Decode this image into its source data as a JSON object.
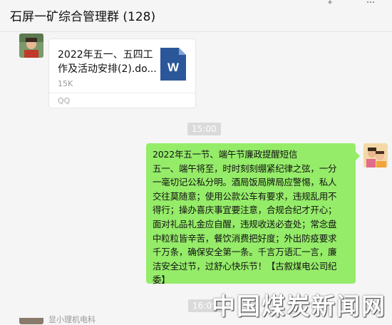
{
  "header": {
    "title": "石屏一矿综合管理群 (128)",
    "pin_icon": "pin-icon",
    "more_icon": "more-icon"
  },
  "messages": {
    "file": {
      "name": "2022年五一、五四工作及活动安排(2).do...",
      "size": "15K",
      "source": "QQ",
      "icon": "word-file-icon",
      "icon_letter": "W",
      "icon_color": "#2b579a"
    },
    "time_1": "15:00",
    "text_message": {
      "lines": [
        "2022年五一节、端午节廉政提醒短信",
        "五一、端午将至，时时刻刻绷紧纪律之弦，一分",
        "一毫切记公私分明。酒局饭局牌局应警惕，私人",
        "交往莫随意；使用公款公车有要求，违规乱用不",
        "得行；操办喜庆事宜要注意，合规合纪才开心；",
        "面对礼品礼金应自醒，违规收送必查处；常念盘",
        "中粒粒皆辛苦，餐饮消费把好度；外出防疫要求",
        "千万条，确保安全第一条。千言万语汇一言，廉",
        "洁安全过节，过舒心快乐节！【古叙煤电公司纪",
        "委】"
      ],
      "bubble_color": "#95ec69"
    },
    "time_2": "16:05",
    "next_sender": "显小理机电科"
  },
  "watermark": "中国煤炭新闻网"
}
